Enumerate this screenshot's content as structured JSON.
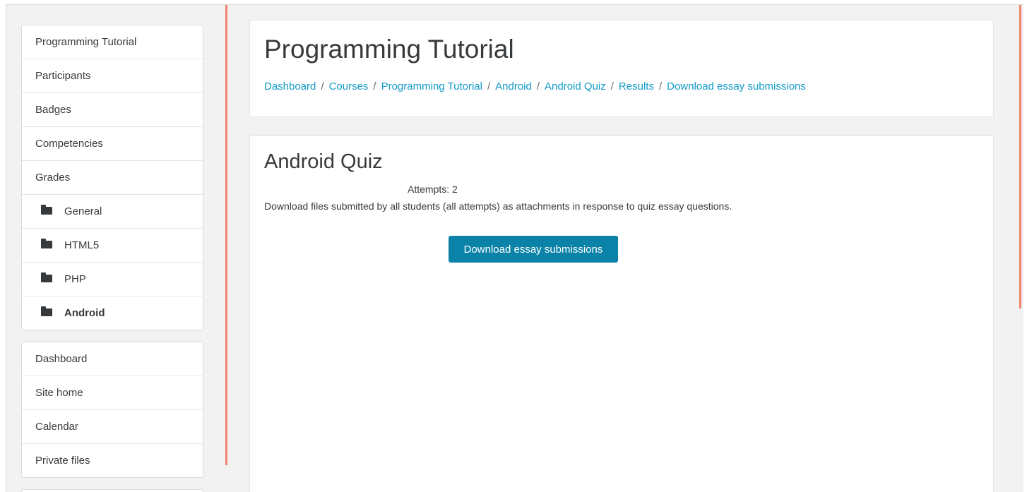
{
  "sidebar": {
    "course_nav": [
      {
        "label": "Programming Tutorial",
        "type": "link"
      },
      {
        "label": "Participants",
        "type": "link"
      },
      {
        "label": "Badges",
        "type": "link"
      },
      {
        "label": "Competencies",
        "type": "link"
      },
      {
        "label": "Grades",
        "type": "link"
      },
      {
        "label": "General",
        "type": "section",
        "icon": "folder-icon"
      },
      {
        "label": "HTML5",
        "type": "section",
        "icon": "folder-icon"
      },
      {
        "label": "PHP",
        "type": "section",
        "icon": "folder-icon"
      },
      {
        "label": "Android",
        "type": "section",
        "icon": "folder-icon",
        "active": true
      }
    ],
    "site_nav": [
      {
        "label": "Dashboard"
      },
      {
        "label": "Site home"
      },
      {
        "label": "Calendar"
      },
      {
        "label": "Private files"
      }
    ]
  },
  "header": {
    "title": "Programming Tutorial",
    "breadcrumb": [
      "Dashboard",
      "Courses",
      "Programming Tutorial",
      "Android",
      "Android Quiz",
      "Results",
      "Download essay submissions"
    ],
    "separator": "/"
  },
  "main": {
    "quiz_title": "Android Quiz",
    "attempts": "Attempts: 2",
    "description": "Download files submitted by all students (all attempts) as attachments in response to quiz essay questions.",
    "download_button": "Download essay submissions"
  },
  "colors": {
    "accent": "#0b83a8",
    "link": "#139ac8",
    "divider": "#f0836a",
    "text": "#373a3c"
  }
}
